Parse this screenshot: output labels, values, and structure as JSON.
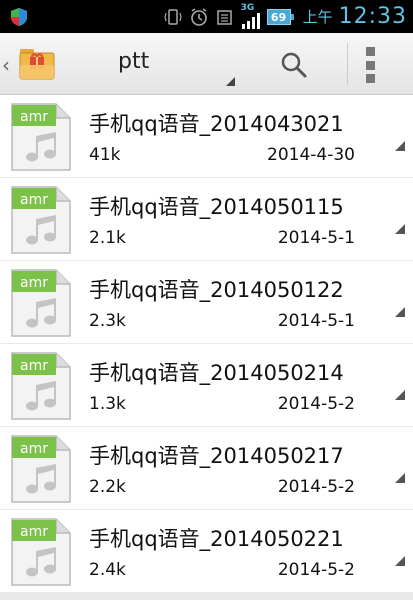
{
  "status_bar": {
    "network": "3G",
    "battery": "69",
    "ampm": "上午",
    "time": "12:33"
  },
  "action_bar": {
    "title": "ptt",
    "back_icon": "chevron-left-icon",
    "app_icon": "gift-folder-icon",
    "search_icon": "search-icon",
    "overflow_icon": "overflow-menu-icon"
  },
  "files": [
    {
      "name": "手机qq语音_2014043021",
      "size": "41k",
      "date": "2014-4-30",
      "type": "amr"
    },
    {
      "name": "手机qq语音_2014050115",
      "size": "2.1k",
      "date": "2014-5-1",
      "type": "amr"
    },
    {
      "name": "手机qq语音_2014050122",
      "size": "2.3k",
      "date": "2014-5-1",
      "type": "amr"
    },
    {
      "name": "手机qq语音_2014050214",
      "size": "1.3k",
      "date": "2014-5-2",
      "type": "amr"
    },
    {
      "name": "手机qq语音_2014050217",
      "size": "2.2k",
      "date": "2014-5-2",
      "type": "amr"
    },
    {
      "name": "手机qq语音_2014050221",
      "size": "2.4k",
      "date": "2014-5-2",
      "type": "amr"
    }
  ],
  "colors": {
    "accent": "#5fc2e6",
    "amr_green": "#7cc24a",
    "row_bg": "#ffffff",
    "list_bg": "#e9e9e9"
  }
}
